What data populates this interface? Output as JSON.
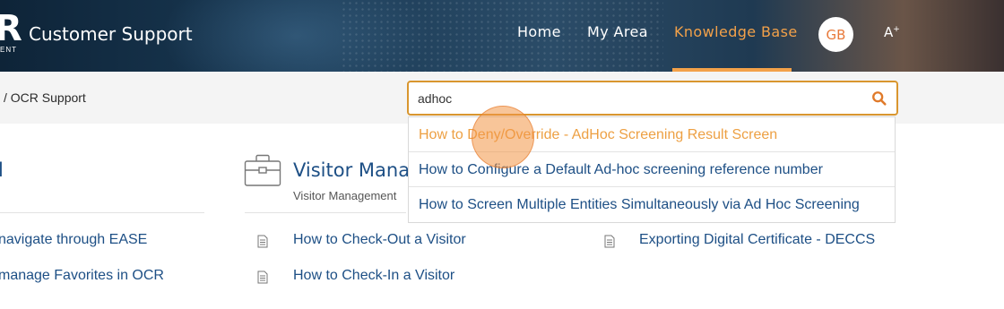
{
  "header": {
    "logo_mark": "R",
    "logo_sub": "ENT",
    "brand": "Customer Support",
    "nav": [
      {
        "label": "Home"
      },
      {
        "label": "My Area"
      },
      {
        "label": "Knowledge Base",
        "active": true
      }
    ],
    "avatar": "GB",
    "font_size_control": "A"
  },
  "breadcrumb": "/  OCR Support",
  "search": {
    "value": "adhoc",
    "icon": "search-icon"
  },
  "suggestions": [
    "How to Deny/Override - AdHoc Screening Result Screen",
    "How to Configure a Default Ad-hoc screening reference number",
    "How to Screen Multiple Entities Simultaneously via Ad Hoc Screening"
  ],
  "sections": {
    "left": {
      "title": "l",
      "links": [
        "navigate through EASE",
        "manage Favorites in OCR"
      ]
    },
    "middle": {
      "title": "Visitor Manager",
      "subtitle": "Visitor Management",
      "links": [
        "How to Check-Out a Visitor",
        "How to Check-In a Visitor"
      ]
    },
    "right": {
      "links": [
        "Exporting Digital Certificate - DECCS"
      ]
    }
  },
  "colors": {
    "accent": "#f3a149",
    "link": "#1d4f85",
    "search_border": "#d9962f"
  }
}
